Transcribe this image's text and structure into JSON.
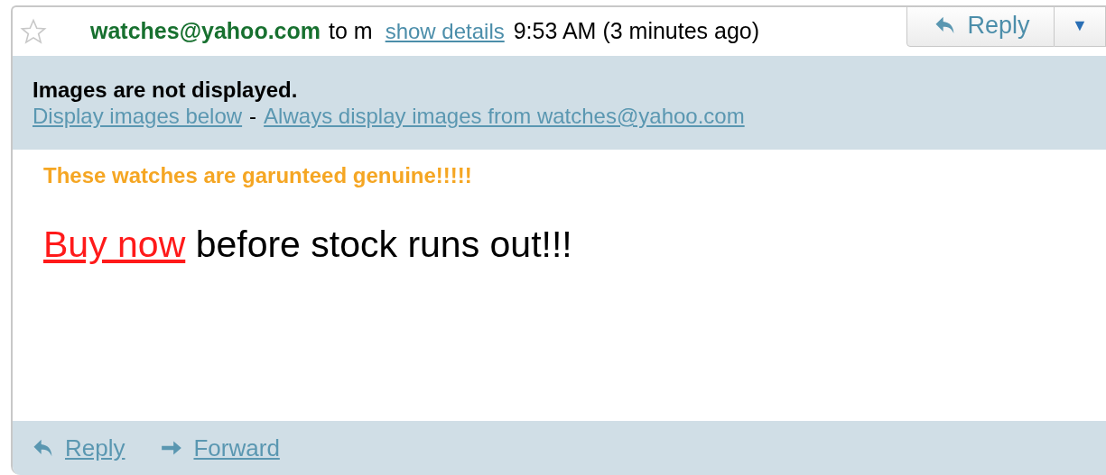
{
  "header": {
    "starred": false,
    "sender": "watches@yahoo.com",
    "recipient": "to m",
    "details_link": "show details",
    "time": "9:53 AM (3 minutes ago)",
    "reply_button": "Reply",
    "menu_caret": "▼"
  },
  "notice": {
    "title": "Images are not displayed.",
    "links": [
      "Display images below",
      "Always display images from watches@yahoo.com"
    ],
    "separator": "-"
  },
  "body": {
    "tagline": "These watches are garunteed genuine!!!!!",
    "link": "Buy now",
    "sentence_rest": " before stock runs out!!!"
  },
  "footer": {
    "actions": [
      {
        "kind": "reply",
        "label": "Reply"
      },
      {
        "kind": "forward",
        "label": "Forward"
      }
    ]
  }
}
